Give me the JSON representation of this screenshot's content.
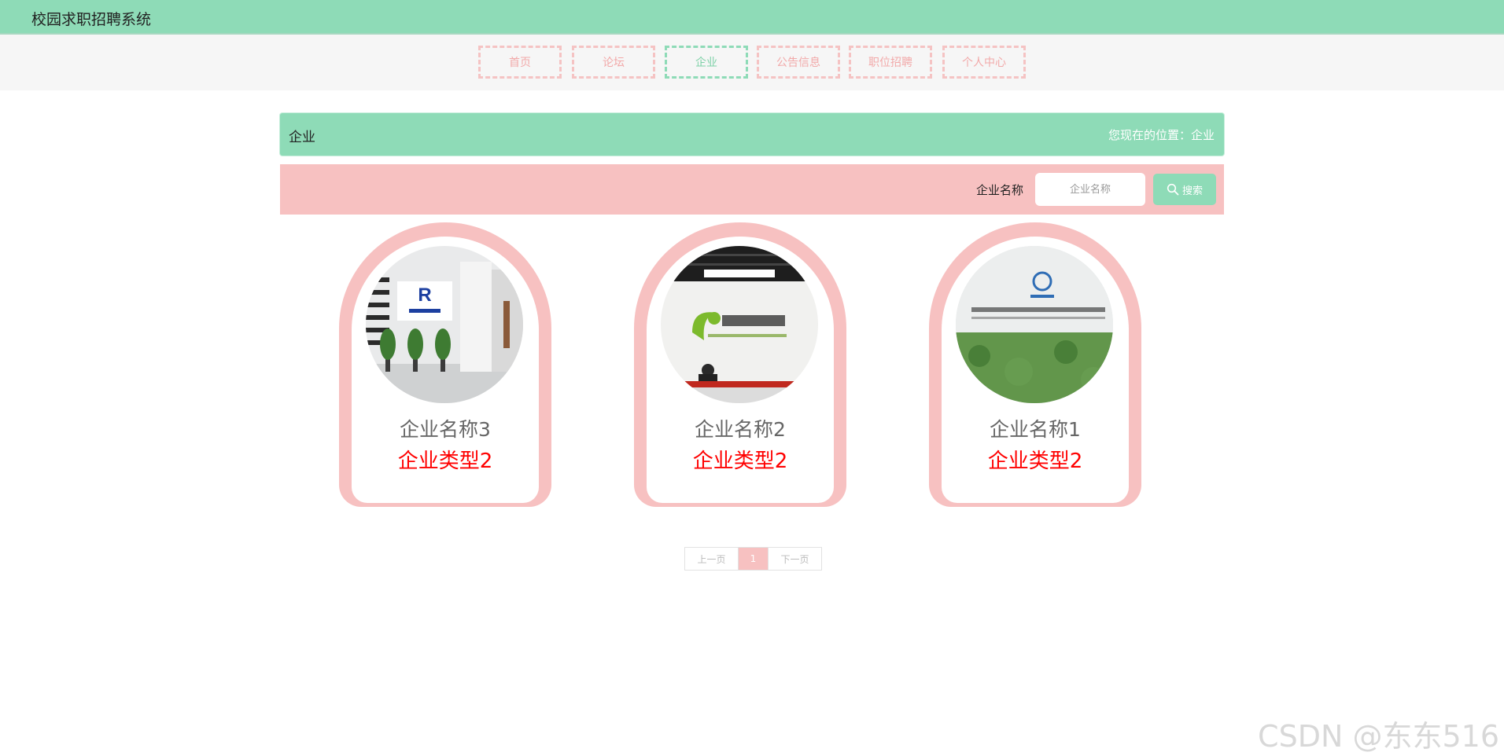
{
  "header": {
    "title": "校园求职招聘系统",
    "bg_color": "#8edbb7"
  },
  "nav": {
    "items": [
      {
        "label": "首页"
      },
      {
        "label": "论坛"
      },
      {
        "label": "企业"
      },
      {
        "label": "公告信息"
      },
      {
        "label": "职位招聘"
      },
      {
        "label": "个人中心"
      }
    ],
    "active_index": 2
  },
  "breadcrumb": {
    "title": "企业",
    "location": "您现在的位置：企业"
  },
  "search": {
    "label": "企业名称",
    "placeholder": "企业名称",
    "value": "",
    "button_label": "搜索",
    "button_icon": "search-icon"
  },
  "companies": [
    {
      "name": "企业名称3",
      "type": "企业类型2",
      "photo": "lobby-blue-logo-wall"
    },
    {
      "name": "企业名称2",
      "type": "企业类型2",
      "photo": "reception-desk-green-logo"
    },
    {
      "name": "企业名称1",
      "type": "企业类型2",
      "photo": "reception-green-wall"
    }
  ],
  "pagination": {
    "prev": "上一页",
    "current": "1",
    "next": "下一页"
  },
  "watermark": "CSDN @东东516",
  "colors": {
    "accent_green": "#8edbb7",
    "accent_pink": "#f7c1c1",
    "type_red": "#ff0000"
  }
}
